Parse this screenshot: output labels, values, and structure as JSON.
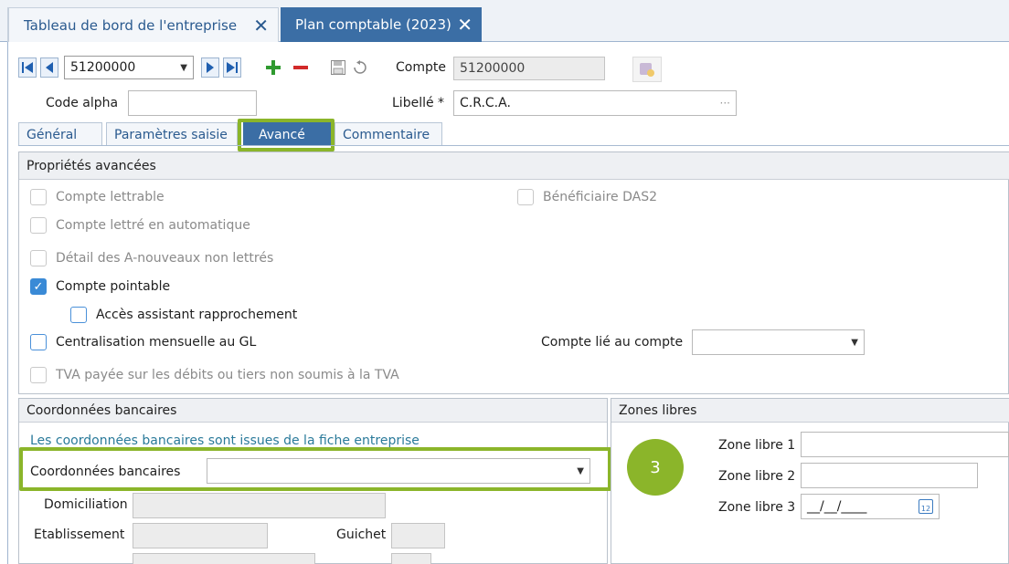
{
  "tabs": [
    {
      "label": "Tableau de bord de l'entreprise",
      "close": "✕"
    },
    {
      "label": "Plan comptable (2023)",
      "close": "✕"
    }
  ],
  "toolbar": {
    "account_selector": "51200000",
    "compte_label": "Compte",
    "compte_value": "51200000"
  },
  "header": {
    "code_alpha_label": "Code alpha",
    "code_alpha_value": "",
    "libelle_label": "Libellé *",
    "libelle_value": "C.R.C.A.",
    "libelle_more": "···"
  },
  "subtabs": [
    {
      "label": "Général"
    },
    {
      "label": "Paramètres saisie"
    },
    {
      "label": "Avancé"
    },
    {
      "label": "Commentaire"
    }
  ],
  "proprietes": {
    "title": "Propriétés avancées",
    "options": [
      {
        "label": "Compte lettrable",
        "checked": false,
        "enabled": false
      },
      {
        "label": "Bénéficiaire DAS2",
        "checked": false,
        "enabled": false
      },
      {
        "label": "Compte lettré en automatique",
        "checked": false,
        "enabled": false
      },
      {
        "label": "Détail des A-nouveaux non lettrés",
        "checked": false,
        "enabled": false
      },
      {
        "label": "Compte pointable",
        "checked": true,
        "enabled": true
      },
      {
        "label": "Accès assistant rapprochement",
        "checked": false,
        "enabled": true
      },
      {
        "label": "Centralisation mensuelle au GL",
        "checked": false,
        "enabled": true
      },
      {
        "label": "TVA payée sur les débits ou tiers non soumis à la TVA",
        "checked": false,
        "enabled": false
      }
    ],
    "compte_lie_label": "Compte lié au compte",
    "compte_lie_value": ""
  },
  "coordonnees": {
    "title": "Coordonnées bancaires",
    "info": "Les coordonnées bancaires sont issues de la fiche entreprise",
    "select_label": "Coordonnées bancaires",
    "select_value": "",
    "domiciliation_label": "Domiciliation",
    "etablissement_label": "Etablissement",
    "guichet_label": "Guichet"
  },
  "zones": {
    "title": "Zones libres",
    "zone1_label": "Zone libre 1",
    "zone2_label": "Zone libre 2",
    "zone3_label": "Zone libre 3",
    "zone3_value": "__/__/____"
  },
  "callout": {
    "number": "3"
  },
  "colors": {
    "accent": "#3b6ea5",
    "highlight": "#8bb52a",
    "check": "#3a8ad6"
  }
}
